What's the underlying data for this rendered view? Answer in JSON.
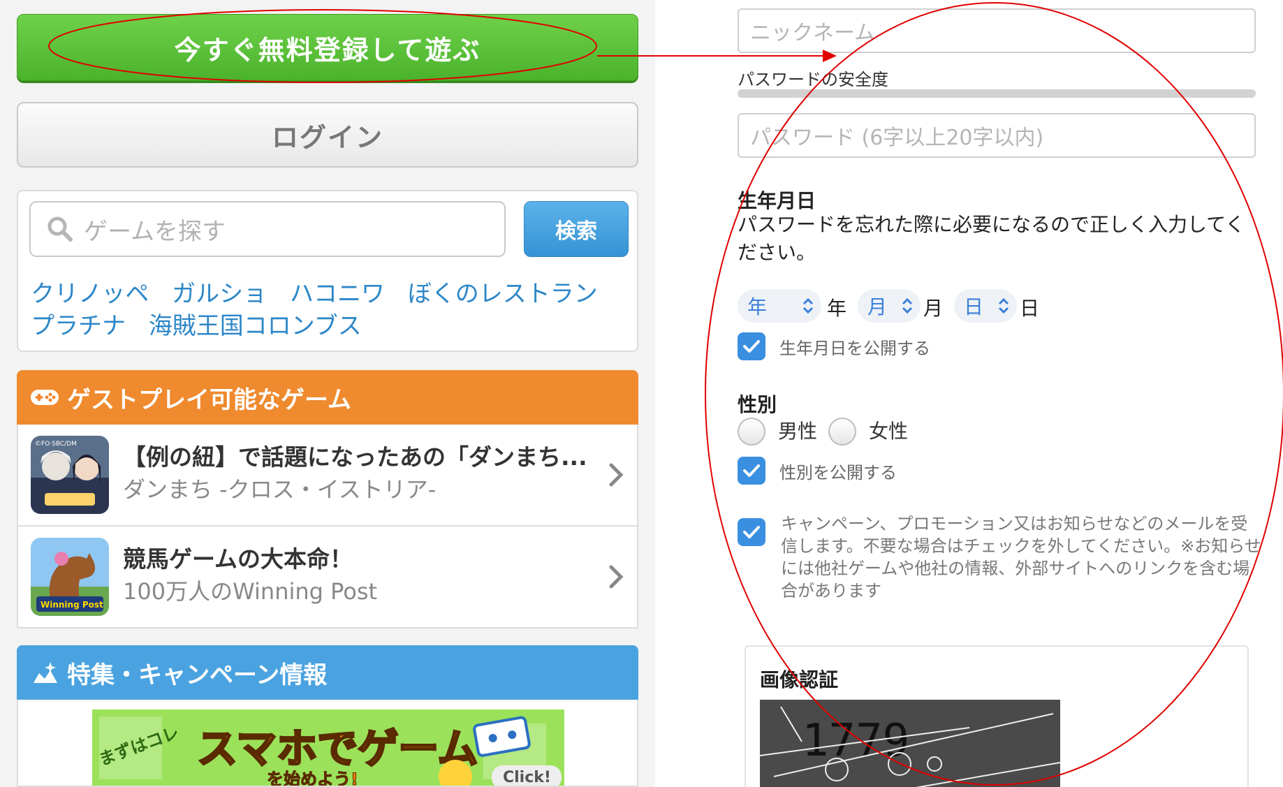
{
  "left": {
    "register_button": "今すぐ無料登録して遊ぶ",
    "login_button": "ログイン",
    "search": {
      "placeholder": "ゲームを探す",
      "button": "検索",
      "tags_line1": [
        "クリノッペ",
        "ガルショ",
        "ハコニワ",
        "ぼくのレストラン"
      ],
      "tags_line2": [
        "プラチナ",
        "海賊王国コロンブス"
      ]
    },
    "guest_section": {
      "title": "ゲストプレイ可能なゲーム",
      "games": [
        {
          "title": "【例の紐】で話題になったあの「ダンまち...",
          "subtitle": "ダンまち -クロス・イストリア-",
          "thumb_text": "©FO·SBC/DM"
        },
        {
          "title": "競馬ゲームの大本命！",
          "subtitle": "100万人のWinning Post",
          "thumb_text": "Winning Post"
        }
      ]
    },
    "campaign_section": {
      "title": "特集・キャンペーン情報",
      "banner": {
        "badge": "まずはコレ",
        "headline": "スマホでゲーム",
        "sub": "を始めよう!",
        "click": "Click!"
      }
    }
  },
  "right": {
    "nickname_placeholder": "ニックネーム",
    "password_strength_label": "パスワードの安全度",
    "password_strength": 0,
    "password_placeholder": "パスワード (6字以上20字以内)",
    "birth": {
      "heading": "生年月日",
      "description": "パスワードを忘れた際に必要になるので正しく入力してください。",
      "year_select": "年",
      "year_unit": "年",
      "month_select": "月",
      "month_unit": "月",
      "day_select": "日",
      "day_unit": "日",
      "publish_label": "生年月日を公開する",
      "publish_checked": true
    },
    "gender": {
      "heading": "性別",
      "male": "男性",
      "female": "女性",
      "publish_label": "性別を公開する",
      "publish_checked": true
    },
    "promo": {
      "checked": true,
      "text": "キャンペーン、プロモーション又はお知らせなどのメールを受信します。不要な場合はチェックを外してください。※お知らせには他社ゲームや他社の情報、外部サイトへのリンクを含む場合があります"
    },
    "captcha": {
      "heading": "画像認証",
      "code": "1779"
    }
  },
  "colors": {
    "register_green": "#4bb22c",
    "guest_orange": "#ef8a2e",
    "campaign_blue": "#4aa3e0",
    "checkbox_blue": "#3a8fe0",
    "annotation_red": "#e00000"
  }
}
